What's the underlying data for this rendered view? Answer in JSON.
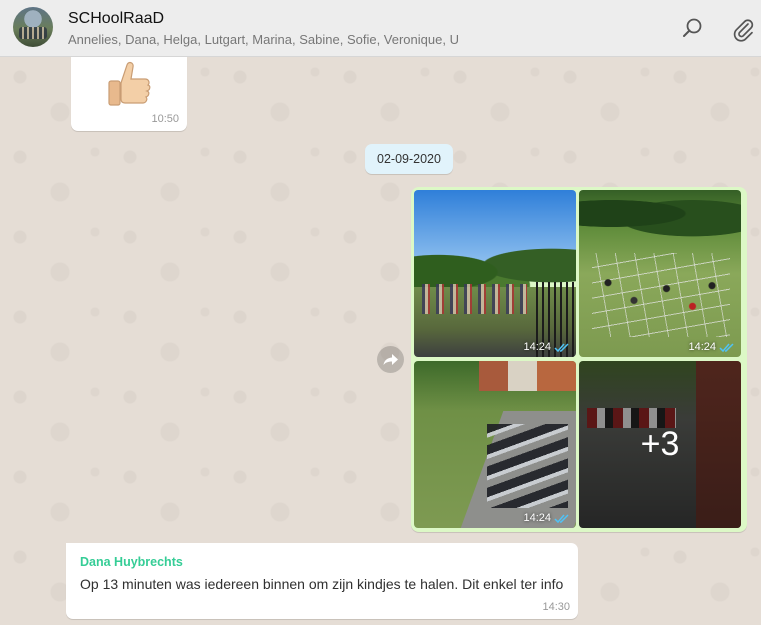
{
  "header": {
    "title": "SCHoolRaaD",
    "members": "Annelies, Dana, Helga, Lutgart, Marina, Sabine, Sofie, Veronique, U"
  },
  "messages": {
    "sticker": {
      "emoji": "👍",
      "time": "10:50"
    },
    "date_divider": "02-09-2020",
    "album": {
      "photos": [
        {
          "time": "14:24",
          "status": "read"
        },
        {
          "time": "14:24",
          "status": "read"
        },
        {
          "time": "14:24",
          "status": "read"
        }
      ],
      "more_count": "+3"
    },
    "text": {
      "sender": "Dana Huybrechts",
      "body": "Op 13 minuten was iedereen binnen om zijn kindjes te halen. Dit enkel ter info",
      "time": "14:30"
    }
  },
  "icons": {
    "search": "search-icon",
    "attach": "paperclip-icon",
    "forward": "forward-icon",
    "read_ticks": "double-check-icon"
  },
  "colors": {
    "header_bg": "#ededed",
    "chat_bg": "#e5ddd5",
    "outgoing_bubble": "#dcf8c6",
    "incoming_bubble": "#ffffff",
    "date_chip": "#e1f3fb",
    "sender_name": "#35cd96",
    "read_ticks": "#4fc3f7"
  }
}
